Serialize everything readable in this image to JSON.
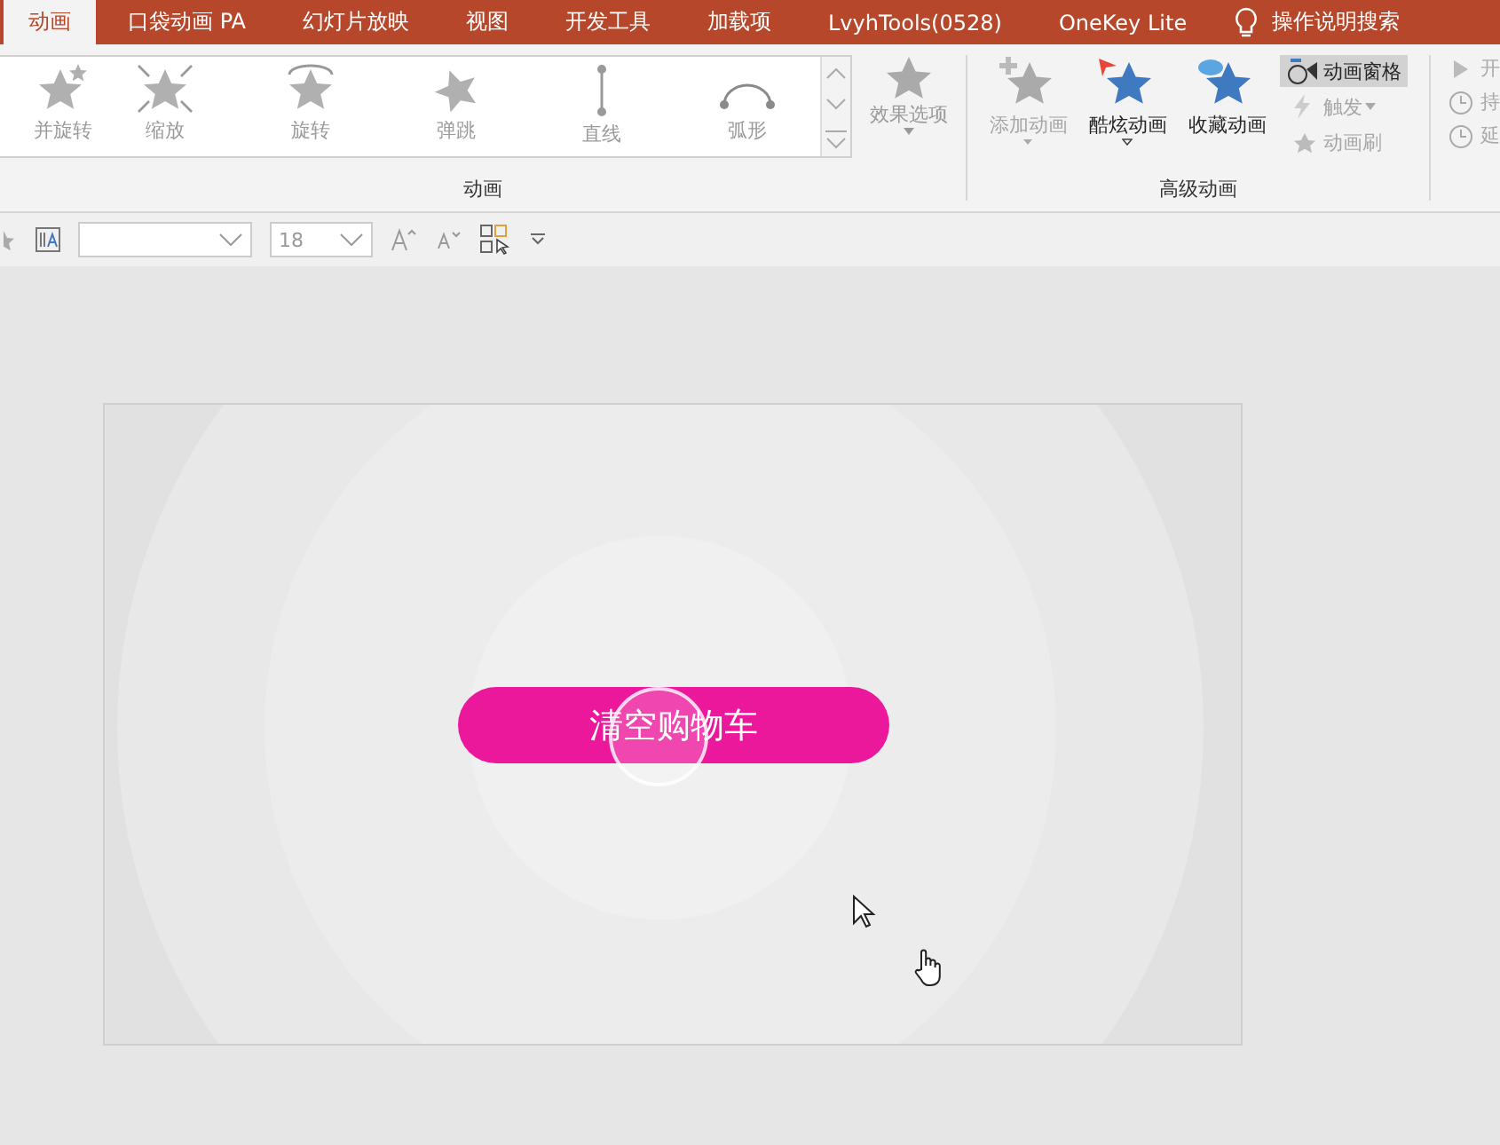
{
  "tabs": [
    {
      "label": "动画",
      "selected": true
    },
    {
      "label": "口袋动画 PA",
      "selected": false
    },
    {
      "label": "幻灯片放映",
      "selected": false
    },
    {
      "label": "视图",
      "selected": false
    },
    {
      "label": "开发工具",
      "selected": false
    },
    {
      "label": "加载项",
      "selected": false
    },
    {
      "label": "LvyhTools(0528)",
      "selected": false
    },
    {
      "label": "OneKey Lite",
      "selected": false
    }
  ],
  "help_search": "操作说明搜索",
  "gallery": {
    "items": [
      {
        "label": "并旋转",
        "kind": "spin"
      },
      {
        "label": "缩放",
        "kind": "zoom"
      },
      {
        "label": "旋转",
        "kind": "rotate"
      },
      {
        "label": "弹跳",
        "kind": "bounce"
      },
      {
        "label": "直线",
        "kind": "line"
      },
      {
        "label": "弧形",
        "kind": "arc"
      }
    ],
    "effect_options": "效果选项",
    "group_label": "动画"
  },
  "advanced": {
    "big_buttons": [
      {
        "label": "添加动画",
        "kind": "add",
        "disabled": true,
        "dropdown": true
      },
      {
        "label": "酷炫动画",
        "kind": "cool",
        "disabled": false,
        "dropdown": true
      },
      {
        "label": "收藏动画",
        "kind": "collect",
        "disabled": false,
        "dropdown": false
      }
    ],
    "small_buttons": [
      {
        "label": "动画窗格",
        "kind": "pane",
        "disabled": false,
        "selected": true
      },
      {
        "label": "触发",
        "kind": "trigger",
        "disabled": true,
        "selected": false
      },
      {
        "label": "动画刷",
        "kind": "painter",
        "disabled": true,
        "selected": false
      }
    ],
    "group_label": "高级动画"
  },
  "timing": [
    {
      "label": "开",
      "kind": "start"
    },
    {
      "label": "持",
      "kind": "duration"
    },
    {
      "label": "延",
      "kind": "delay"
    }
  ],
  "format_bar": {
    "font_size": "18"
  },
  "slide": {
    "button_label": "清空购物车"
  }
}
